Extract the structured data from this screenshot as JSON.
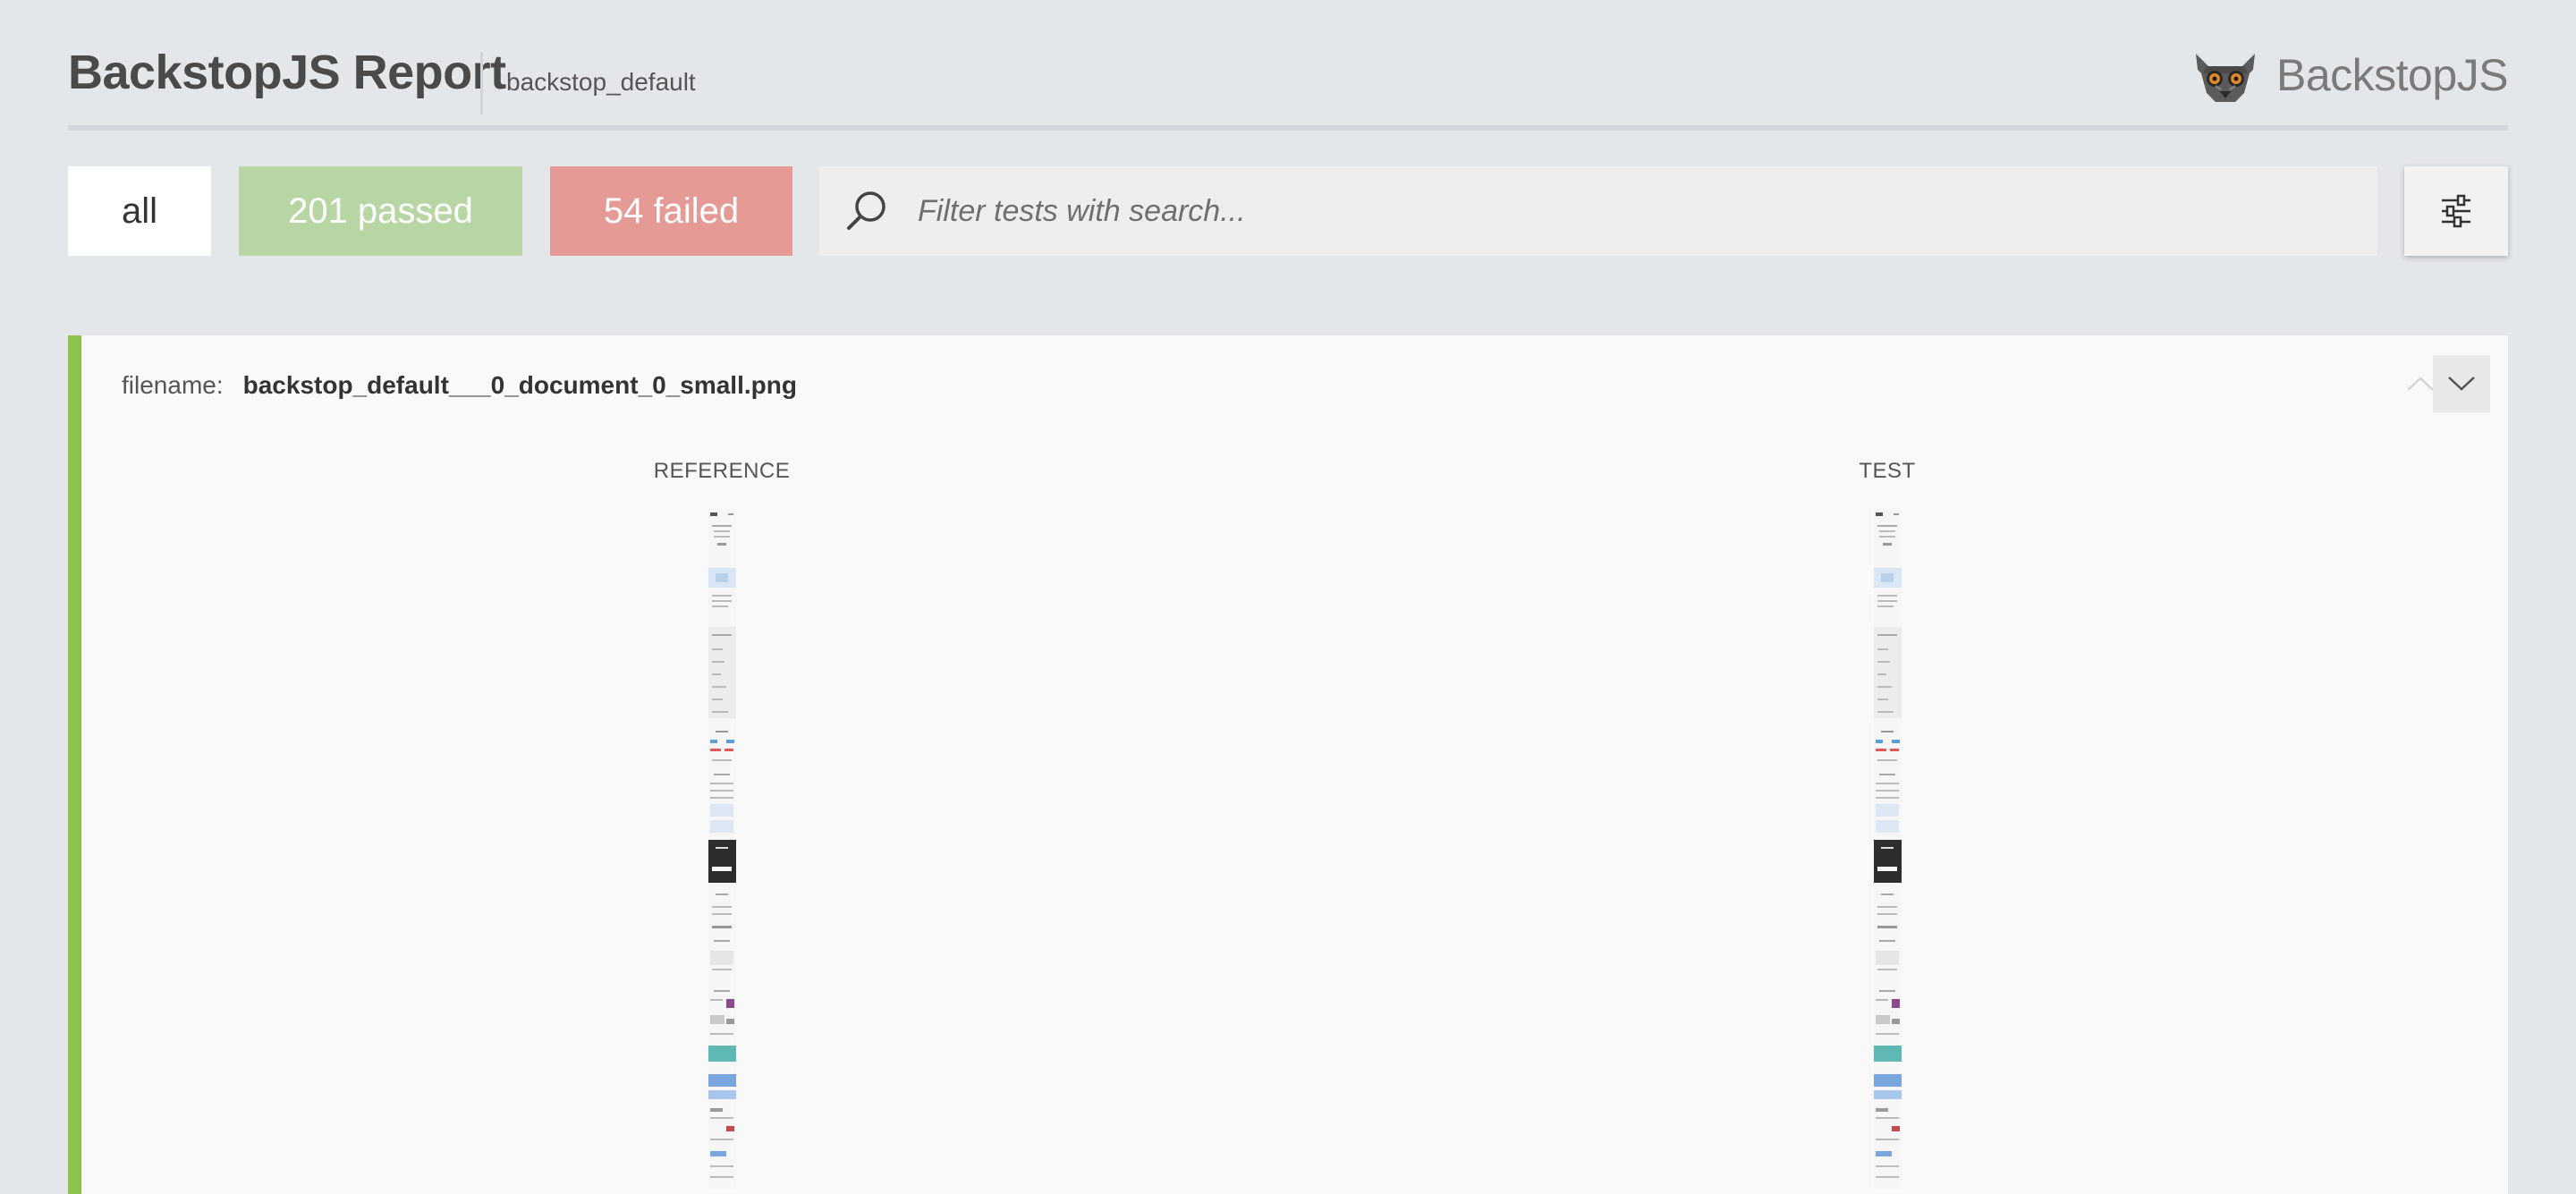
{
  "header": {
    "title": "BackstopJS Report",
    "subtitle": "backstop_default",
    "brand_name": "BackstopJS",
    "brand_icon": "lemur-logo-icon"
  },
  "toolbar": {
    "all_label": "all",
    "passed_label": "201 passed",
    "failed_label": "54 failed",
    "search_placeholder": "Filter tests with search...",
    "search_value": "",
    "search_icon": "search-icon",
    "settings_icon": "settings-sliders-icon"
  },
  "colors": {
    "background": "#e4e7ea",
    "passed": "#b8d6a4",
    "failed": "#e59a96",
    "status_pass_bar": "#8dc24f"
  },
  "test": {
    "filename_label": "filename:",
    "filename": "backstop_default___0_document_0_small.png",
    "reference_label": "REFERENCE",
    "test_label": "TEST",
    "status": "passed",
    "up_icon": "chevron-up-icon",
    "down_icon": "chevron-down-icon"
  }
}
